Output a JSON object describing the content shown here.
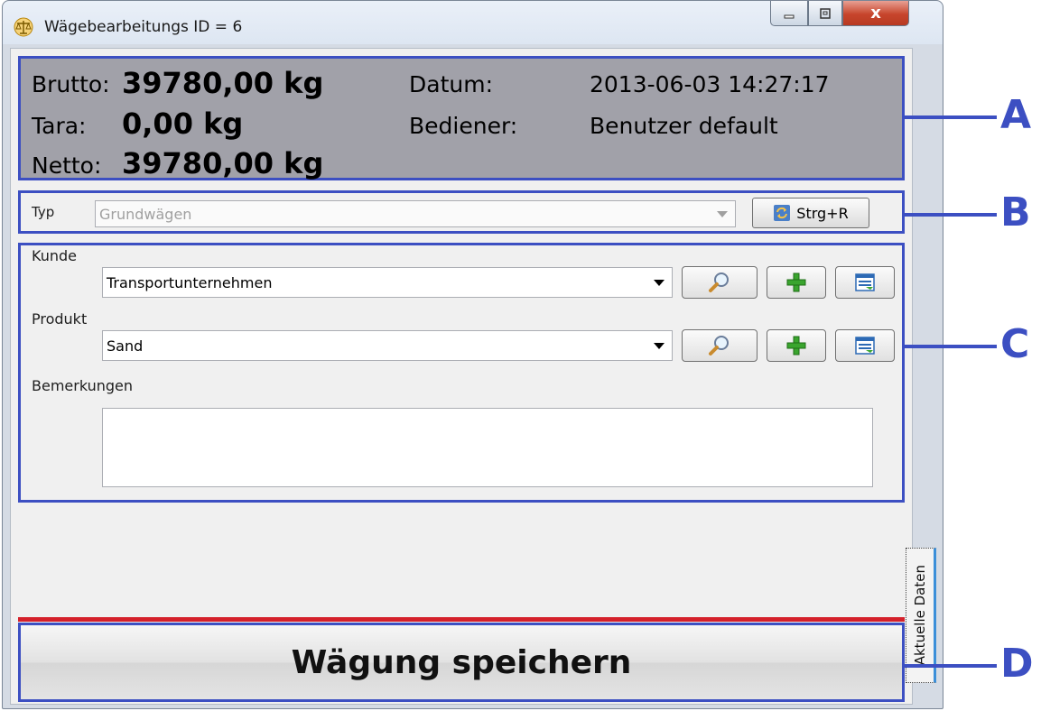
{
  "window": {
    "title": "Wägebearbeitungs ID = 6",
    "icon": "scale-icon",
    "minimize_label": "▁",
    "maximize_label": "▢",
    "close_label": "x"
  },
  "info": {
    "brutto_label": "Brutto:",
    "brutto_value": "39780,00 kg",
    "tara_label": "Tara:",
    "tara_value": "0,00 kg",
    "netto_label": "Netto:",
    "netto_value": "39780,00 kg",
    "datum_label": "Datum:",
    "datum_value": "2013-06-03 14:27:17",
    "bediener_label": "Bediener:",
    "bediener_value": "Benutzer default"
  },
  "typ": {
    "label": "Typ",
    "value": "Grundwägen",
    "shortcut_button": "Strg+R"
  },
  "form": {
    "kunde_label": "Kunde",
    "kunde_value": "Transportunternehmen",
    "produkt_label": "Produkt",
    "produkt_value": "Sand",
    "bemerkungen_label": "Bemerkungen",
    "bemerkungen_value": ""
  },
  "actions": {
    "save_label": "Wägung speichern"
  },
  "side_tab": {
    "label": "Aktuelle Daten"
  },
  "annotations": [
    "A",
    "B",
    "C",
    "D"
  ],
  "colors": {
    "annotation_blue": "#3c4fc2",
    "info_panel_bg": "#a1a1a9",
    "separator_red": "#d4202a",
    "close_red": "#c7452c"
  }
}
